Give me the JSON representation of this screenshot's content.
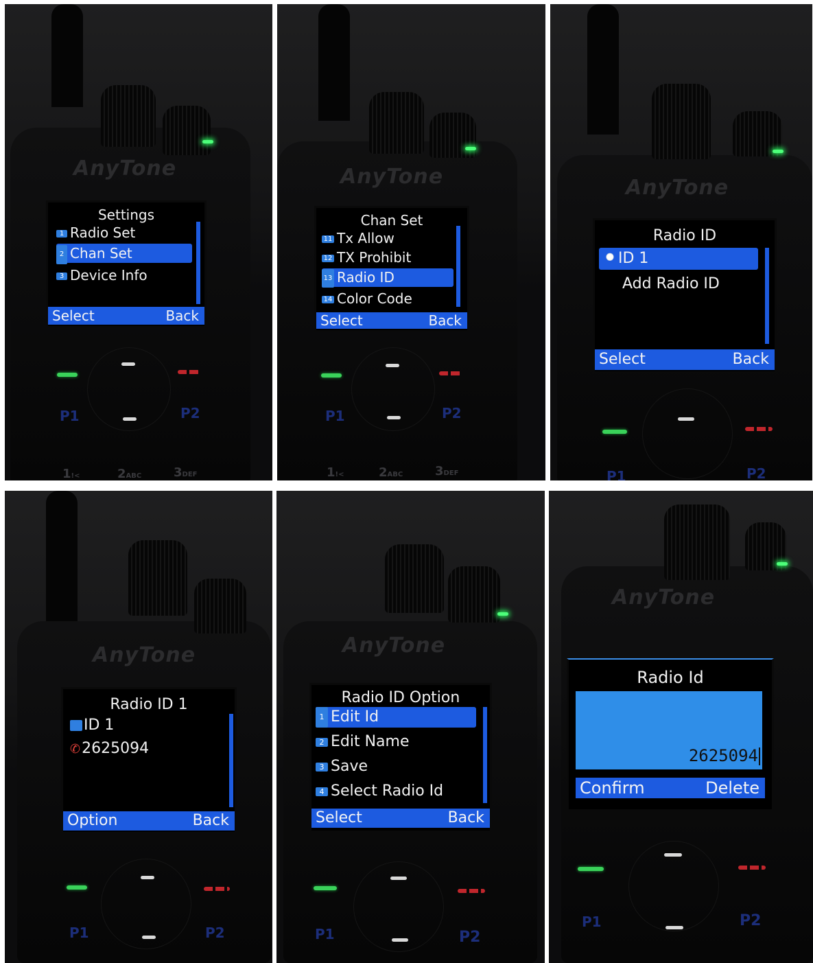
{
  "brand": "AnyTone",
  "keys": {
    "p1": "P1",
    "p2": "P2",
    "k1": "1",
    "k1_sub": "!<",
    "k2": "2",
    "k2_sub": "ABC",
    "k3": "3",
    "k3_sub": "DEF"
  },
  "panels": [
    {
      "title": "Settings",
      "items": [
        {
          "num": "1",
          "label": "Radio Set",
          "selected": false
        },
        {
          "num": "2",
          "label": "Chan Set",
          "selected": true
        },
        {
          "num": "3",
          "label": "Device Info",
          "selected": false
        }
      ],
      "softkeys": {
        "left": "Select",
        "right": "Back"
      }
    },
    {
      "title": "Chan Set",
      "items": [
        {
          "num": "11",
          "label": "Tx Allow",
          "selected": false
        },
        {
          "num": "12",
          "label": "TX Prohibit",
          "selected": false
        },
        {
          "num": "13",
          "label": "Radio ID",
          "selected": true
        },
        {
          "num": "14",
          "label": "Color Code",
          "selected": false
        }
      ],
      "softkeys": {
        "left": "Select",
        "right": "Back"
      }
    },
    {
      "title": "Radio ID",
      "items": [
        {
          "label": "ID 1",
          "selected": true,
          "icon": "contact-icon"
        },
        {
          "label": "Add Radio ID",
          "selected": false
        }
      ],
      "softkeys": {
        "left": "Select",
        "right": "Back"
      }
    },
    {
      "title": "Radio ID 1",
      "name": "ID 1",
      "number": "2625094",
      "softkeys": {
        "left": "Option",
        "right": "Back"
      }
    },
    {
      "title": "Radio ID Option",
      "items": [
        {
          "num": "1",
          "label": "Edit Id",
          "selected": true
        },
        {
          "num": "2",
          "label": "Edit Name",
          "selected": false
        },
        {
          "num": "3",
          "label": "Save",
          "selected": false
        },
        {
          "num": "4",
          "label": "Select Radio Id",
          "selected": false
        }
      ],
      "softkeys": {
        "left": "Select",
        "right": "Back"
      }
    },
    {
      "title": "Radio Id",
      "input_value": "2625094",
      "softkeys": {
        "left": "Confirm",
        "right": "Delete"
      }
    }
  ],
  "colors": {
    "highlight": "#1d5be0",
    "led": "#4dff7a",
    "background": "#0c0c0d"
  }
}
